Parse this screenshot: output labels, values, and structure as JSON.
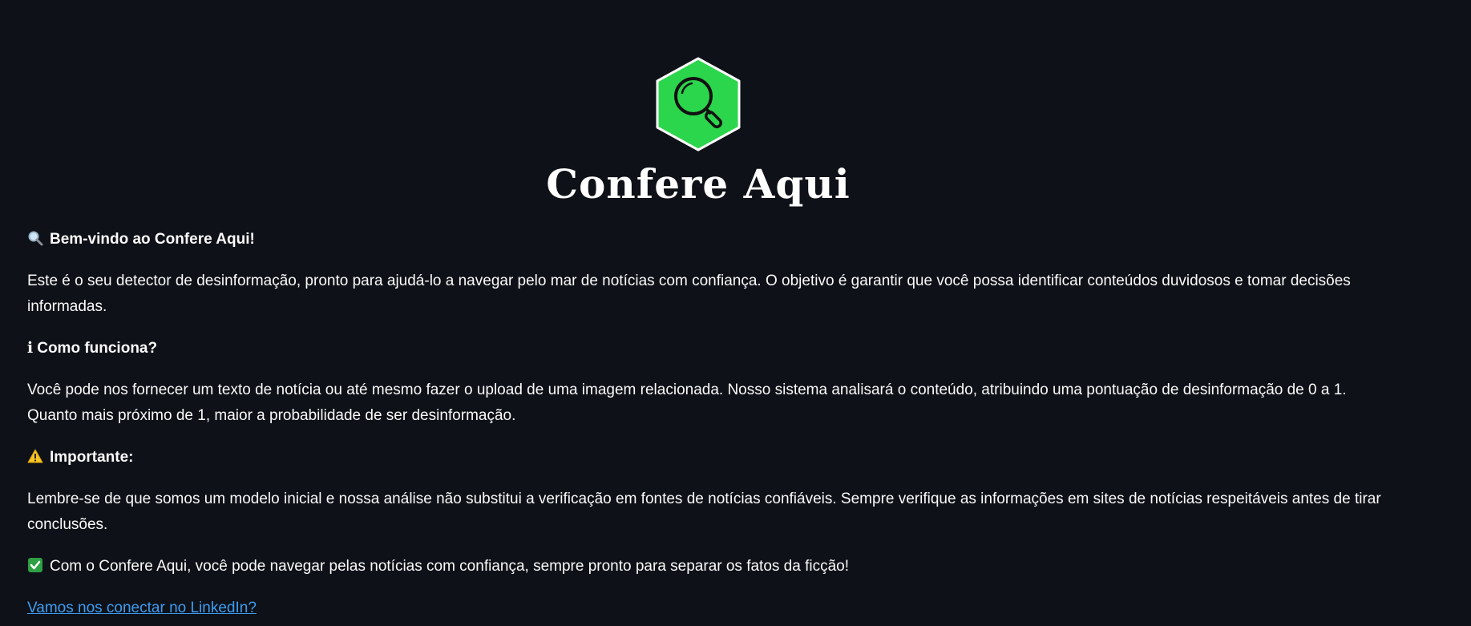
{
  "logo": {
    "brand_name": "Confere Aqui",
    "icon": "magnifier-hexagon-icon",
    "hex_color": "#2bd54c"
  },
  "welcome": {
    "icon": "magnifying-glass-icon",
    "heading": "Bem-vindo ao Confere Aqui!",
    "text": "Este é o seu detector de desinformação, pronto para ajudá-lo a navegar pelo mar de notícias com confiança. O objetivo é garantir que você possa identificar conteúdos duvidosos e tomar decisões informadas."
  },
  "how_it_works": {
    "icon_glyph": "ℹ",
    "heading": "Como funciona?",
    "text": "Você pode nos fornecer um texto de notícia ou até mesmo fazer o upload de uma imagem relacionada. Nosso sistema analisará o conteúdo, atribuindo uma pontuação de desinformação de 0 a 1. Quanto mais próximo de 1, maior a probabilidade de ser desinformação."
  },
  "important": {
    "icon": "warning-icon",
    "heading": "Importante:",
    "text": "Lembre-se de que somos um modelo inicial e nossa análise não substitui a verificação em fontes de notícias confiáveis. Sempre verifique as informações em sites de notícias respeitáveis antes de tirar conclusões."
  },
  "closing": {
    "icon": "check-mark-icon",
    "text": "Com o Confere Aqui, você pode navegar pelas notícias com confiança, sempre pronto para separar os fatos da ficção!"
  },
  "linkedin_link": {
    "label": "Vamos nos conectar no LinkedIn?"
  }
}
